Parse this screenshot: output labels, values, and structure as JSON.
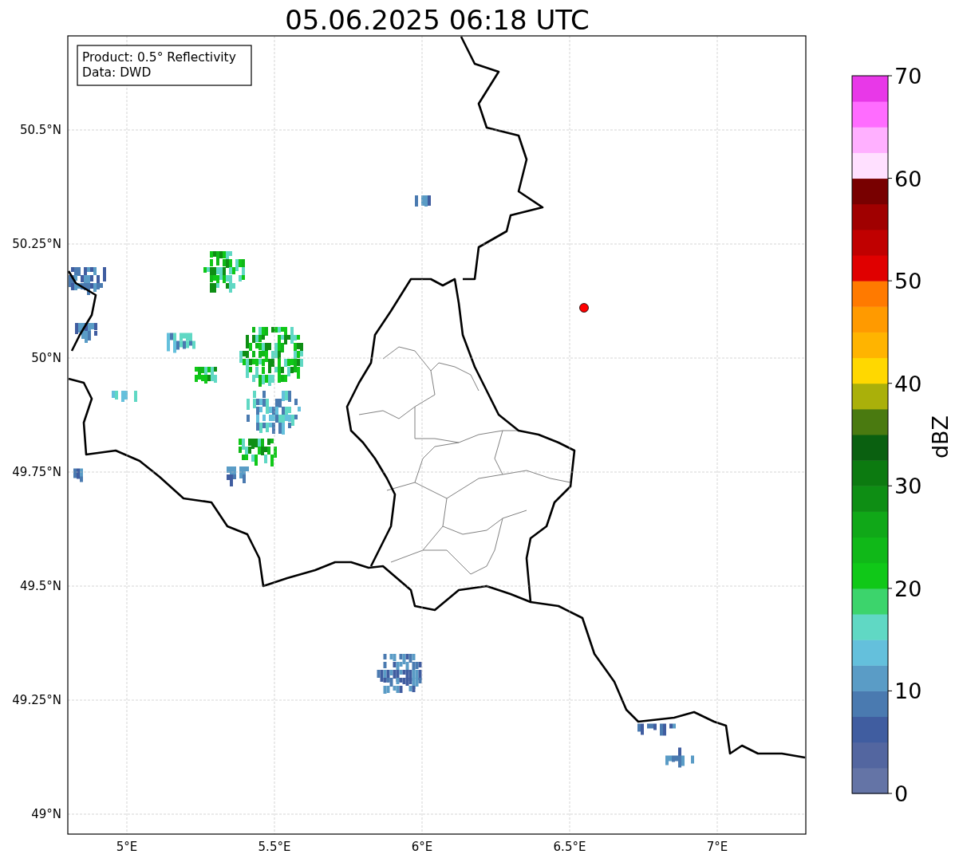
{
  "title": "05.06.2025 06:18 UTC",
  "legend": [
    "Product: 0.5° Reflectivity",
    "Data: DWD"
  ],
  "map": {
    "yticks": [
      "50.5°N",
      "50.25°N",
      "50°N",
      "49.75°N",
      "49.5°N",
      "49.25°N",
      "49°N"
    ],
    "xticks": [
      "5°E",
      "5.5°E",
      "6°E",
      "6.5°E",
      "7°E"
    ]
  },
  "colorbar": {
    "label": "dBZ",
    "ticks": [
      "70",
      "60",
      "50",
      "40",
      "30",
      "20",
      "10",
      "0"
    ],
    "bands": [
      {
        "color": "#6474a6"
      },
      {
        "color": "#5366a0"
      },
      {
        "color": "#405da0"
      },
      {
        "color": "#4a7ab0"
      },
      {
        "color": "#5a9cc6"
      },
      {
        "color": "#64c0dc"
      },
      {
        "color": "#60d8c4"
      },
      {
        "color": "#3cd46c"
      },
      {
        "color": "#10c818"
      },
      {
        "color": "#10b818"
      },
      {
        "color": "#10a818"
      },
      {
        "color": "#0e8e14"
      },
      {
        "color": "#0c7a10"
      },
      {
        "color": "#0a6010"
      },
      {
        "color": "#4a7a10"
      },
      {
        "color": "#aab00a"
      },
      {
        "color": "#ffd800"
      },
      {
        "color": "#ffb400"
      },
      {
        "color": "#ff9a00"
      },
      {
        "color": "#ff7a00"
      },
      {
        "color": "#e00000"
      },
      {
        "color": "#c00000"
      },
      {
        "color": "#a00000"
      },
      {
        "color": "#780000"
      },
      {
        "color": "#ffe0ff"
      },
      {
        "color": "#ffb0ff"
      },
      {
        "color": "#ff6cff"
      },
      {
        "color": "#e838e8"
      }
    ]
  }
}
